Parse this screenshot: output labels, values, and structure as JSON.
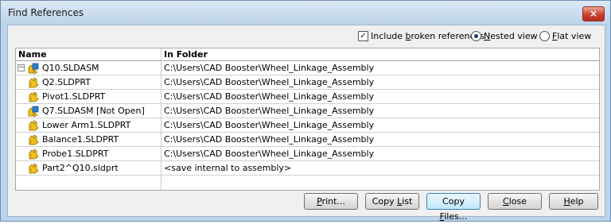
{
  "window": {
    "title": "Find References",
    "close_glyph": "×"
  },
  "options": {
    "include_broken": {
      "pre": "Include ",
      "ul": "b",
      "post": "roken references",
      "checked": true
    },
    "nested_view": {
      "pre": "",
      "ul": "N",
      "post": "ested view",
      "selected": true
    },
    "flat_view": {
      "pre": "",
      "ul": "F",
      "post": "lat view",
      "selected": false
    }
  },
  "table": {
    "columns": {
      "name": "Name",
      "folder": "In Folder"
    },
    "rows": [
      {
        "name": "Q10.SLDASM",
        "folder": "C:\\Users\\CAD Booster\\Wheel_Linkage_Assembly",
        "icon": "assembly-icon",
        "expander": "−"
      },
      {
        "name": "Q2.SLDPRT",
        "folder": "C:\\Users\\CAD Booster\\Wheel_Linkage_Assembly",
        "icon": "part-icon"
      },
      {
        "name": "Pivot1.SLDPRT",
        "folder": "C:\\Users\\CAD Booster\\Wheel_Linkage_Assembly",
        "icon": "part-icon"
      },
      {
        "name": "Q7.SLDASM [Not Open]",
        "folder": "C:\\Users\\CAD Booster\\Wheel_Linkage_Assembly",
        "icon": "assembly-icon"
      },
      {
        "name": "Lower Arm1.SLDPRT",
        "folder": "C:\\Users\\CAD Booster\\Wheel_Linkage_Assembly",
        "icon": "part-icon"
      },
      {
        "name": "Balance1.SLDPRT",
        "folder": "C:\\Users\\CAD Booster\\Wheel_Linkage_Assembly",
        "icon": "part-icon"
      },
      {
        "name": "Probe1.SLDPRT",
        "folder": "C:\\Users\\CAD Booster\\Wheel_Linkage_Assembly",
        "icon": "part-icon"
      },
      {
        "name": "Part2^Q10.sldprt",
        "folder": "<save internal to assembly>",
        "icon": "part-icon"
      }
    ]
  },
  "buttons": {
    "print": {
      "ul": "P",
      "post": "rint..."
    },
    "copy_list": {
      "pre": "Copy ",
      "ul": "L",
      "post": "ist"
    },
    "copy_files": {
      "pre": "Copy ",
      "ul": "F",
      "post": "iles..."
    },
    "close": {
      "ul": "C",
      "post": "lose"
    },
    "help": {
      "ul": "H",
      "post": "elp"
    }
  },
  "colors": {
    "part": "#f2c21a",
    "assembly_blue": "#2a7fd4"
  }
}
